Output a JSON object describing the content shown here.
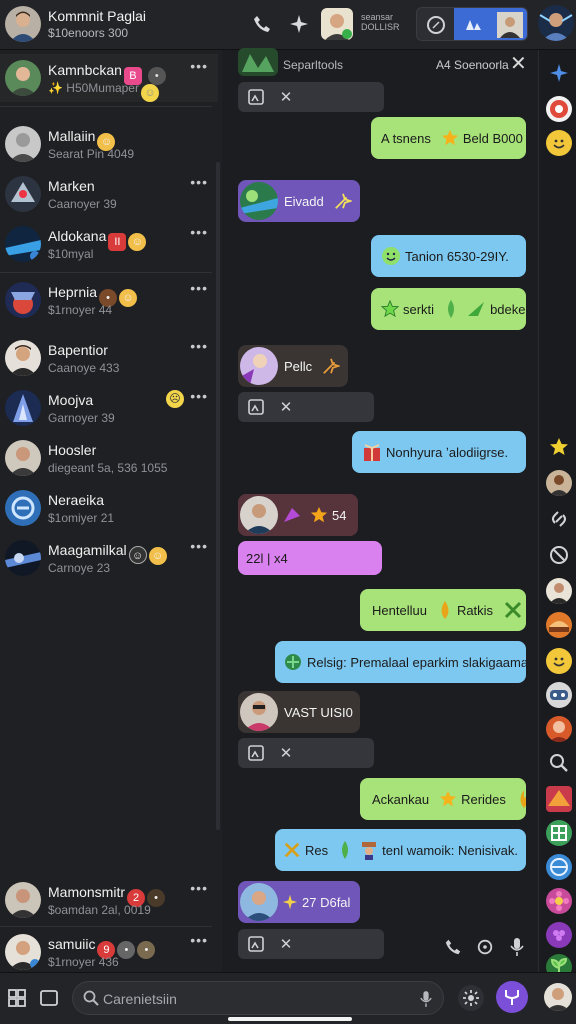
{
  "header": {
    "title": "Kommnit Paglai",
    "subtitle": "$10enoors 300",
    "mini_text_1": "seansar",
    "mini_text_2": "DOLLISR"
  },
  "conversations": [
    {
      "name": "Kamnbckan",
      "preview": "✨ H50Mumaper",
      "badge_color": "#e84a8c",
      "emoji": "🙂"
    },
    {
      "name": "Mallaiin",
      "preview": "Searat Pin 4049",
      "emoji": "🙂"
    },
    {
      "name": "Marken",
      "preview": "Caanoyer 39"
    },
    {
      "name": "Aldokana",
      "preview": "$10myal",
      "emoji": "🙂"
    },
    {
      "name": "Heprnia",
      "preview": "$1rnoyer 44",
      "emoji": "🙂"
    },
    {
      "name": "Bapentior",
      "preview": "Caanoye 433"
    },
    {
      "name": "Moojva",
      "preview": "Garnoyer 39",
      "emoji": "🙂"
    },
    {
      "name": "Hoosler",
      "preview": "diegeant 5a, 536 1055"
    },
    {
      "name": "Neraeika",
      "preview": "$1omiyer 21"
    },
    {
      "name": "Maagamilkal",
      "preview": "Carnoye 23",
      "emoji": "🙂"
    },
    {
      "name": "Mamonsmitr",
      "preview": "$oamdan 2al, 0019"
    },
    {
      "name": "samuiic",
      "preview": "$1rnoyer 436"
    }
  ],
  "chat": {
    "header_title": "Separltools",
    "header_right": "A4 Soenoorla",
    "messages": [
      {
        "text": "A tsnens",
        "text2": "Beld B000"
      },
      {
        "text": "Eivadd"
      },
      {
        "text": "Tanion 6530-29IY."
      },
      {
        "text": "serkti",
        "text2": "bdeke"
      },
      {
        "text": "Pellc"
      },
      {
        "text": "Nonhyura ʼalodiigrse."
      },
      {
        "text": "54"
      },
      {
        "text": "22l | x4"
      },
      {
        "text": "Hentelluu",
        "text2": "Ratkis"
      },
      {
        "text": "Relsig: Premalaal eparkim slakigaama"
      },
      {
        "text": "VAST UISI0"
      },
      {
        "text": "Ackankau",
        "text2": "Rerides"
      },
      {
        "text": "Res",
        "text2": "tenl wamoik: Nenisivak."
      },
      {
        "text": "27 D6fal"
      }
    ]
  },
  "search": {
    "placeholder": "Carenietsiin"
  },
  "colors": {
    "accent": "#7b4fd8",
    "green_bubble": "#a8e37a",
    "blue_bubble": "#7cc8f1",
    "purple_bubble": "#6f56b8",
    "pink_bubble": "#d981ee"
  }
}
